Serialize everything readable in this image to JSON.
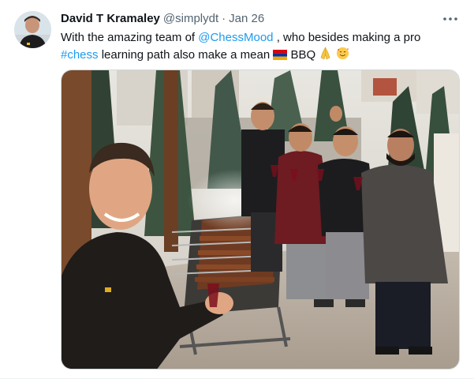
{
  "tweet": {
    "author_name": "David T Kramaley",
    "author_handle": "@simplydt",
    "separator": "·",
    "date": "Jan 26",
    "text": {
      "part1": "With the amazing team of ",
      "mention": "@ChessMood",
      "part2": " , who besides making a pro",
      "hashtag": "#chess",
      "part3": " learning path also make  a mean ",
      "part4": " BBQ "
    },
    "more_icon": "more-horizontal-icon",
    "emojis": [
      "armenia-flag",
      "folded-hands",
      "smiling-face-with-hearts"
    ]
  },
  "colors": {
    "link": "#1d9bf0",
    "text": "#0f1419",
    "muted": "#536471"
  }
}
